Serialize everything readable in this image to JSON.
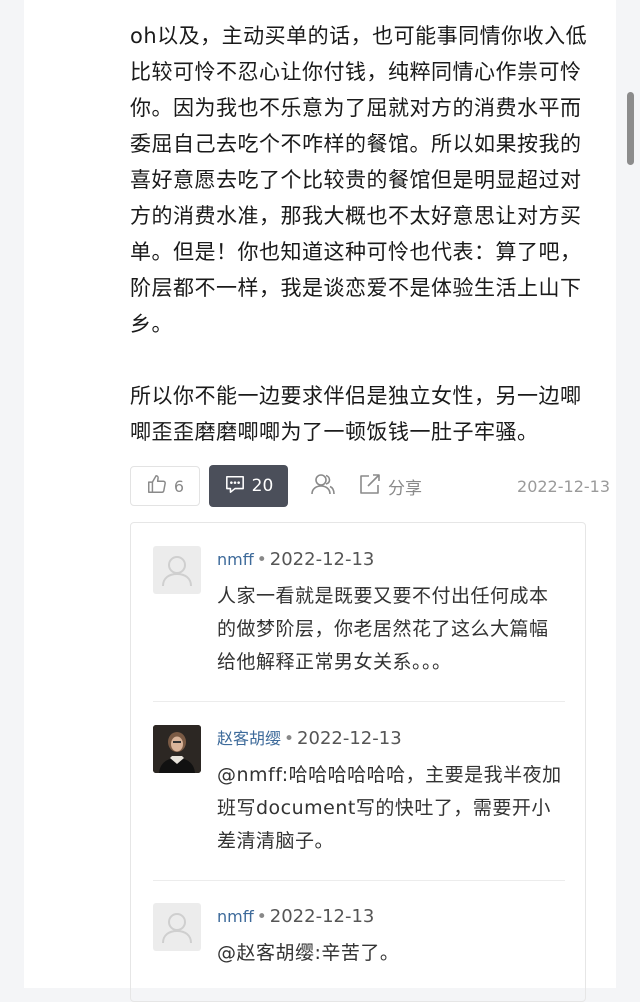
{
  "answer": {
    "paragraph1": "oh以及，主动买单的话，也可能事同情你收入低比较可怜不忍心让你付钱，纯粹同情心作祟可怜你。因为我也不乐意为了屈就对方的消费水平而委屈自己去吃个不咋样的餐馆。所以如果按我的喜好意愿去吃了个比较贵的餐馆但是明显超过对方的消费水准，那我大概也不太好意思让对方买单。但是！你也知道这种可怜也代表：算了吧，阶层都不一样，我是谈恋爱不是体验生活上山下乡。",
    "paragraph2": "所以你不能一边要求伴侣是独立女性，另一边唧唧歪歪磨磨唧唧为了一顿饭钱一肚子牢骚。"
  },
  "actions": {
    "like_count": "6",
    "comment_count": "20",
    "share_label": "分享",
    "date": "2022-12-13"
  },
  "comments": [
    {
      "author": "nmff",
      "date": "2022-12-13",
      "text": "人家一看就是既要又要不付出任何成本的做梦阶层，你老居然花了这么大篇幅给他解释正常男女关系。。。"
    },
    {
      "author": "赵客胡缨",
      "date": "2022-12-13",
      "text": "@nmff:哈哈哈哈哈哈，主要是我半夜加班写document写的快吐了，需要开小差清清脑子。"
    },
    {
      "author": "nmff",
      "date": "2022-12-13",
      "text": "@赵客胡缨:辛苦了。"
    }
  ],
  "colors": {
    "comment_button_bg": "#4b4f5a",
    "author_link": "#3d6a9a"
  }
}
